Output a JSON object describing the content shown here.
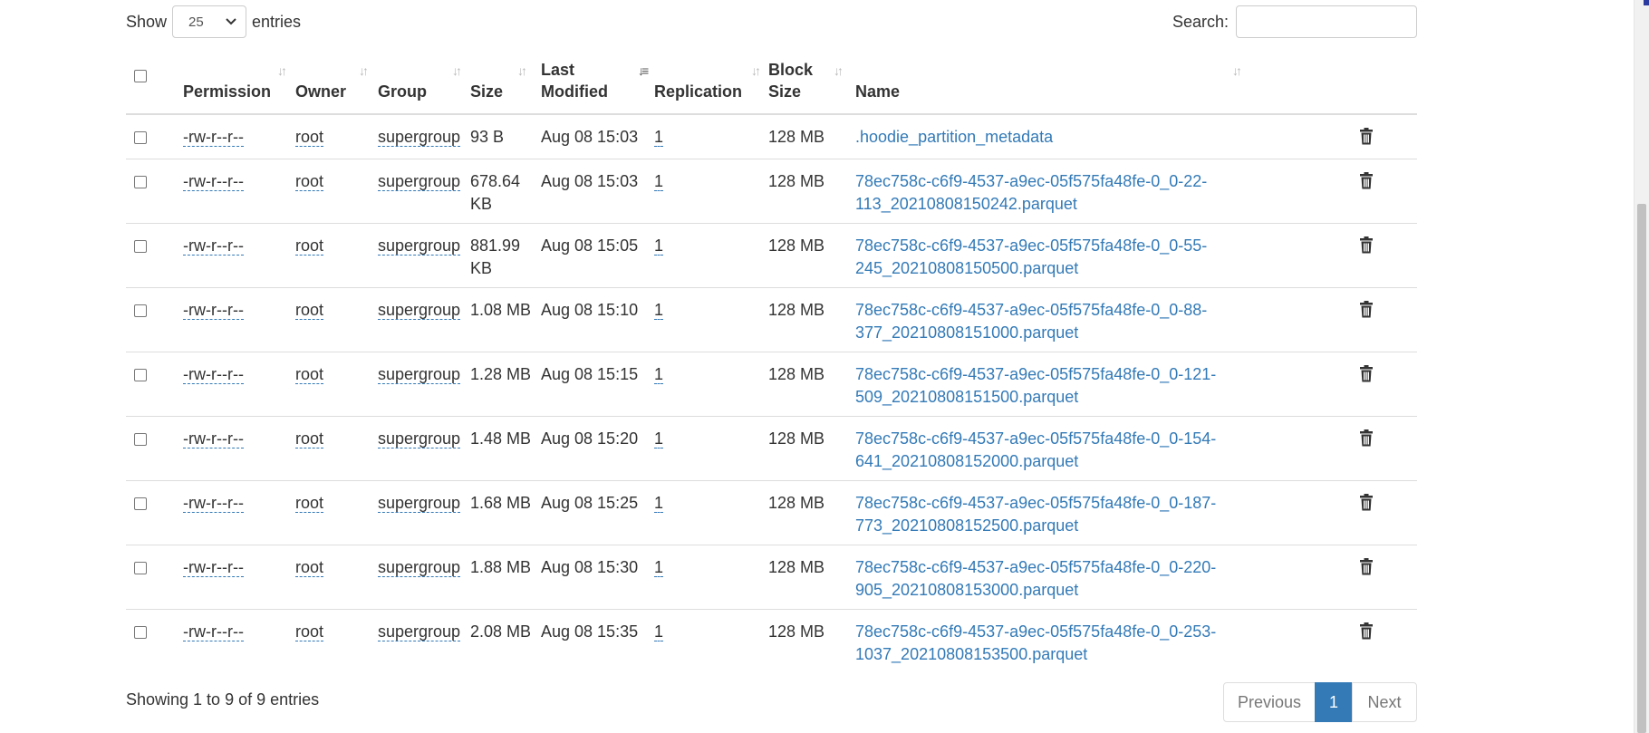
{
  "length": {
    "show_label": "Show",
    "value": "25",
    "entries_label": "entries"
  },
  "search": {
    "label": "Search:",
    "value": ""
  },
  "columns": [
    "",
    "Permission",
    "Owner",
    "Group",
    "Size",
    "Last\nModified",
    "Replication",
    "Block\nSize",
    "Name",
    ""
  ],
  "header": {
    "permission": "Permission",
    "owner": "Owner",
    "group": "Group",
    "size": "Size",
    "last_modified_1": "Last",
    "last_modified_2": "Modified",
    "replication": "Replication",
    "block_size_1": "Block",
    "block_size_2": "Size",
    "name": "Name"
  },
  "rows": [
    {
      "permission": "-rw-r--r--",
      "owner": "root",
      "group": "supergroup",
      "size_1": "93 B",
      "size_2": "",
      "modified": "Aug 08 15:03",
      "replication": "1",
      "block_size": "128 MB",
      "name_1": ".hoodie_partition_metadata",
      "name_2": ""
    },
    {
      "permission": "-rw-r--r--",
      "owner": "root",
      "group": "supergroup",
      "size_1": "678.64",
      "size_2": "KB",
      "modified": "Aug 08 15:03",
      "replication": "1",
      "block_size": "128 MB",
      "name_1": "78ec758c-c6f9-4537-a9ec-05f575fa48fe-0_0-22-",
      "name_2": "113_20210808150242.parquet"
    },
    {
      "permission": "-rw-r--r--",
      "owner": "root",
      "group": "supergroup",
      "size_1": "881.99",
      "size_2": "KB",
      "modified": "Aug 08 15:05",
      "replication": "1",
      "block_size": "128 MB",
      "name_1": "78ec758c-c6f9-4537-a9ec-05f575fa48fe-0_0-55-",
      "name_2": "245_20210808150500.parquet"
    },
    {
      "permission": "-rw-r--r--",
      "owner": "root",
      "group": "supergroup",
      "size_1": "1.08 MB",
      "size_2": "",
      "modified": "Aug 08 15:10",
      "replication": "1",
      "block_size": "128 MB",
      "name_1": "78ec758c-c6f9-4537-a9ec-05f575fa48fe-0_0-88-",
      "name_2": "377_20210808151000.parquet"
    },
    {
      "permission": "-rw-r--r--",
      "owner": "root",
      "group": "supergroup",
      "size_1": "1.28 MB",
      "size_2": "",
      "modified": "Aug 08 15:15",
      "replication": "1",
      "block_size": "128 MB",
      "name_1": "78ec758c-c6f9-4537-a9ec-05f575fa48fe-0_0-121-",
      "name_2": "509_20210808151500.parquet"
    },
    {
      "permission": "-rw-r--r--",
      "owner": "root",
      "group": "supergroup",
      "size_1": "1.48 MB",
      "size_2": "",
      "modified": "Aug 08 15:20",
      "replication": "1",
      "block_size": "128 MB",
      "name_1": "78ec758c-c6f9-4537-a9ec-05f575fa48fe-0_0-154-",
      "name_2": "641_20210808152000.parquet"
    },
    {
      "permission": "-rw-r--r--",
      "owner": "root",
      "group": "supergroup",
      "size_1": "1.68 MB",
      "size_2": "",
      "modified": "Aug 08 15:25",
      "replication": "1",
      "block_size": "128 MB",
      "name_1": "78ec758c-c6f9-4537-a9ec-05f575fa48fe-0_0-187-",
      "name_2": "773_20210808152500.parquet"
    },
    {
      "permission": "-rw-r--r--",
      "owner": "root",
      "group": "supergroup",
      "size_1": "1.88 MB",
      "size_2": "",
      "modified": "Aug 08 15:30",
      "replication": "1",
      "block_size": "128 MB",
      "name_1": "78ec758c-c6f9-4537-a9ec-05f575fa48fe-0_0-220-",
      "name_2": "905_20210808153000.parquet"
    },
    {
      "permission": "-rw-r--r--",
      "owner": "root",
      "group": "supergroup",
      "size_1": "2.08 MB",
      "size_2": "",
      "modified": "Aug 08 15:35",
      "replication": "1",
      "block_size": "128 MB",
      "name_1": "78ec758c-c6f9-4537-a9ec-05f575fa48fe-0_0-253-",
      "name_2": "1037_20210808153500.parquet"
    }
  ],
  "footer": {
    "info": "Showing 1 to 9 of 9 entries",
    "previous": "Previous",
    "current_page": "1",
    "next": "Next"
  },
  "colors": {
    "link": "#337ab7",
    "active_page": "#337ab7",
    "border": "#dddddd"
  },
  "icons": {
    "sort": "sort-icon",
    "delete": "trash-icon",
    "dropdown": "chevron-down-icon"
  }
}
